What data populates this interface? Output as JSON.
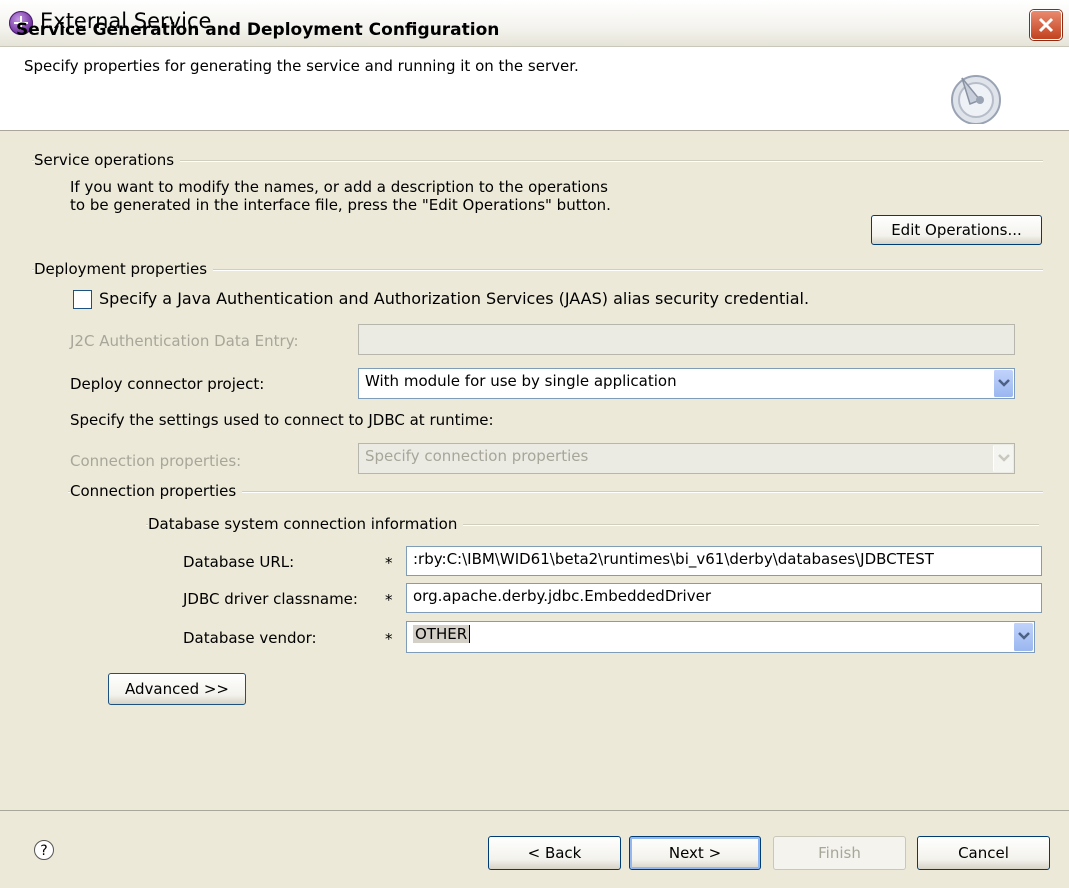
{
  "window": {
    "title": "External Service"
  },
  "header": {
    "title": "Service Generation and Deployment Configuration",
    "description": "Specify properties for generating the service and running it on the server."
  },
  "service_operations": {
    "group_label": "Service operations",
    "description_line1": "If you want to modify the names, or add a description to the operations",
    "description_line2": "to be generated in the interface file, press the \"Edit Operations\" button.",
    "edit_button": "Edit Operations..."
  },
  "deployment": {
    "group_label": "Deployment properties",
    "jaas_checkbox_label": "Specify a Java Authentication and Authorization Services (JAAS) alias security credential.",
    "jaas_checked": false,
    "j2c_label": "J2C Authentication Data Entry:",
    "j2c_value": "",
    "deploy_label": "Deploy connector project:",
    "deploy_value": "With module for use by single application",
    "jdbc_settings_text": "Specify the settings used to connect to JDBC at runtime:",
    "conn_props_label": "Connection properties:",
    "conn_props_value": "Specify connection properties"
  },
  "connection": {
    "group_label": "Connection properties",
    "db_group_label": "Database system connection information",
    "db_url_label": "Database URL:",
    "db_url_value": ":rby:C:\\IBM\\WID61\\beta2\\runtimes\\bi_v61\\derby\\databases\\JDBCTEST",
    "driver_label": "JDBC driver classname:",
    "driver_value": "org.apache.derby.jdbc.EmbeddedDriver",
    "vendor_label": "Database vendor:",
    "vendor_value": "OTHER",
    "required_marker": "*",
    "advanced_button": "Advanced >>"
  },
  "footer": {
    "help": "?",
    "back": "< Back",
    "next": "Next >",
    "finish": "Finish",
    "cancel": "Cancel"
  },
  "icons": {
    "app": "wid-app-icon",
    "close": "close-icon",
    "wizard": "wizard-globe-icon",
    "help": "help-icon",
    "dropdown": "chevron-down-icon"
  }
}
